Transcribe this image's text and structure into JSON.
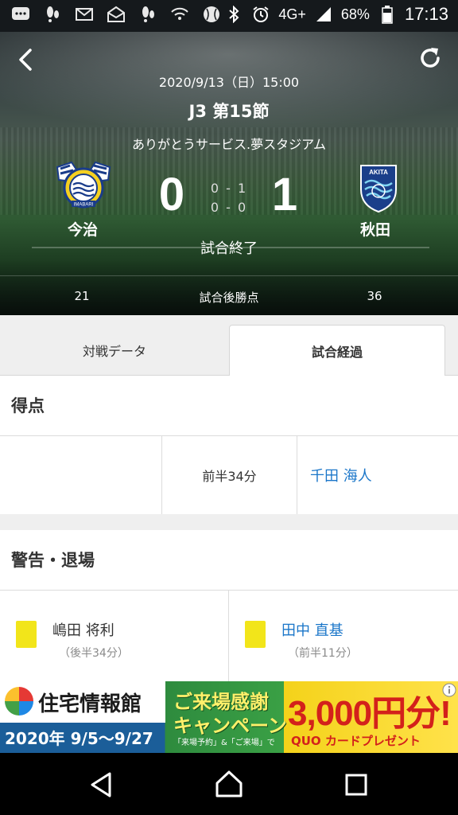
{
  "status_bar": {
    "battery": "68%",
    "time": "17:13",
    "network": "4G+"
  },
  "match": {
    "datetime": "2020/9/13（日）15:00",
    "round": "J3 第15節",
    "venue": "ありがとうサービス.夢スタジアム",
    "status": "試合終了",
    "home": {
      "name": "今治",
      "score": "0",
      "crest_text": "IMABARI",
      "points": "21"
    },
    "away": {
      "name": "秋田",
      "score": "1",
      "crest_text": "AKITA",
      "points": "36"
    },
    "halves": [
      "0 - 1",
      "0 - 0"
    ],
    "points_label": "試合後勝点"
  },
  "tabs": [
    {
      "label": "対戦データ",
      "active": false
    },
    {
      "label": "試合経過",
      "active": true
    }
  ],
  "goals": {
    "heading": "得点",
    "rows": [
      {
        "home_player": "",
        "time": "前半34分",
        "away_player": "千田 海人"
      }
    ]
  },
  "cards": {
    "heading": "警告・退場",
    "home": {
      "player": "嶋田 将利",
      "time": "（後半34分）",
      "type": "yellow"
    },
    "away": {
      "player": "田中 直基",
      "time": "（前半11分）",
      "type": "yellow"
    }
  },
  "ad": {
    "brand": "住宅情報館",
    "dates": "2020年 9/5～9/27",
    "campaign_line1": "ご来場感謝",
    "campaign_line2": "キャンペーン",
    "note": "「来場予約」&「ご来場」で",
    "amount": "3,000円分!",
    "quo": "QUO カードプレゼント"
  },
  "colors": {
    "link_blue": "#1a76c9",
    "yellow_card": "#f2e51a"
  }
}
